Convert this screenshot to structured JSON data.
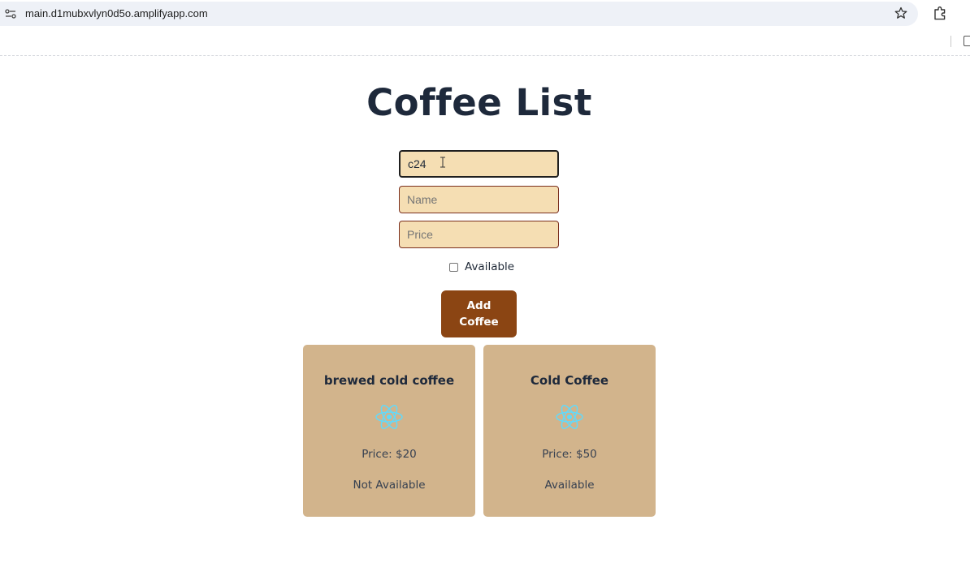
{
  "browser": {
    "url": "main.d1mubxvlyn0d5o.amplifyapp.com"
  },
  "page": {
    "title": "Coffee List"
  },
  "form": {
    "id_value": "c24",
    "name_placeholder": "Name",
    "price_placeholder": "Price",
    "available_label": "Available",
    "available_checked": false,
    "add_button_label": "Add Coffee"
  },
  "coffees": [
    {
      "name": "brewed cold coffee",
      "price": "Price: $20",
      "status": "Not Available",
      "icon": "react-icon"
    },
    {
      "name": "Cold Coffee",
      "price": "Price: $50",
      "status": "Available",
      "icon": "react-icon"
    }
  ],
  "colors": {
    "field_bg": "#f5deb3",
    "field_border": "#7a2e1e",
    "button_bg": "#8b4513",
    "card_bg": "#d2b48c",
    "react_icon": "#61dafb"
  }
}
